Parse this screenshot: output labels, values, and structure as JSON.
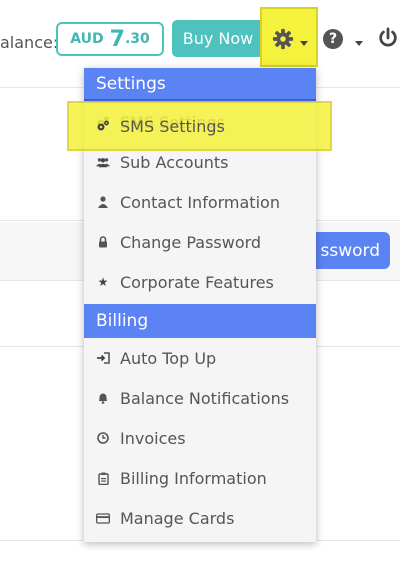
{
  "topbar": {
    "balance_label": "alance:",
    "balance": {
      "currency": "AUD",
      "integer": "7",
      "decimal": ".30"
    },
    "buy_now_label": "Buy Now",
    "icons": {
      "settings": "gear-icon",
      "help": "question-circle-icon",
      "power": "power-icon"
    }
  },
  "background": {
    "button_label": "ssword"
  },
  "menu": {
    "sections": [
      {
        "title": "Settings",
        "items": [
          {
            "label": "SMS Settings",
            "icon": "cogs-icon"
          },
          {
            "label": "Sub Accounts",
            "icon": "users-icon"
          },
          {
            "label": "Contact Information",
            "icon": "user-icon"
          },
          {
            "label": "Change Password",
            "icon": "lock-icon"
          },
          {
            "label": "Corporate Features",
            "icon": "star-icon"
          }
        ]
      },
      {
        "title": "Billing",
        "items": [
          {
            "label": "Auto Top Up",
            "icon": "sign-in-icon"
          },
          {
            "label": "Balance Notifications",
            "icon": "bell-icon"
          },
          {
            "label": "Invoices",
            "icon": "clock-icon"
          },
          {
            "label": "Billing Information",
            "icon": "clipboard-icon"
          },
          {
            "label": "Manage Cards",
            "icon": "credit-card-icon"
          }
        ]
      }
    ]
  },
  "colors": {
    "accent": "#5b83f4",
    "teal": "#4ec3bd",
    "highlight": "#f4f23c"
  }
}
